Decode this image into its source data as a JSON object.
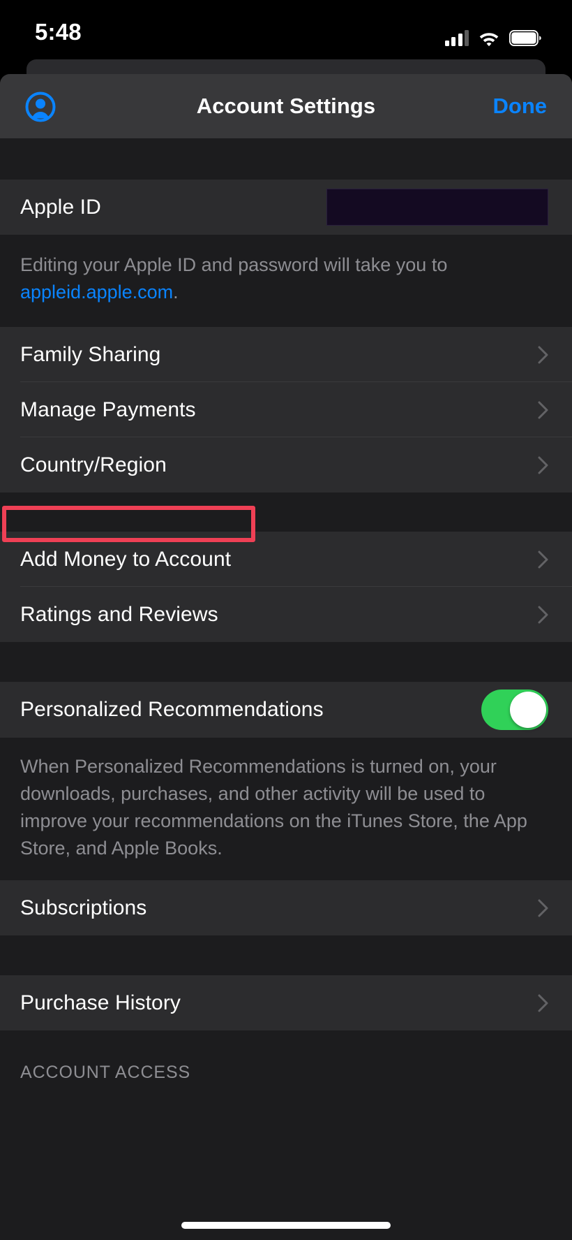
{
  "status_bar": {
    "time": "5:48",
    "cellular_icon": "cellular-signal-icon",
    "cellular_bars_filled": 3,
    "cellular_bars_total": 4,
    "wifi_icon": "wifi-icon",
    "wifi_strength": "full",
    "battery_icon": "battery-icon",
    "battery_level": "full"
  },
  "nav": {
    "avatar_icon": "account-avatar-icon",
    "title": "Account Settings",
    "done_label": "Done"
  },
  "sections": {
    "apple_id": {
      "label": "Apple ID",
      "value_redacted": true,
      "footer_prefix": "Editing your Apple ID and password will take you to ",
      "footer_link": "appleid.apple.com",
      "footer_suffix": "."
    },
    "account_group": {
      "items": [
        {
          "label": "Family Sharing",
          "accessory": "chevron-right-icon"
        },
        {
          "label": "Manage Payments",
          "accessory": "chevron-right-icon"
        },
        {
          "label": "Country/Region",
          "accessory": "chevron-right-icon",
          "highlighted": true
        }
      ]
    },
    "money_group": {
      "items": [
        {
          "label": "Add Money to Account",
          "accessory": "chevron-right-icon"
        },
        {
          "label": "Ratings and Reviews",
          "accessory": "chevron-right-icon"
        }
      ]
    },
    "recommendations": {
      "label": "Personalized Recommendations",
      "toggle_state": "on",
      "footer": "When Personalized Recommendations is turned on, your downloads, purchases, and other activity will be used to improve your recommendations on the iTunes Store, the App Store, and Apple Books."
    },
    "subscriptions": {
      "items": [
        {
          "label": "Subscriptions",
          "accessory": "chevron-right-icon"
        }
      ]
    },
    "purchase_history": {
      "items": [
        {
          "label": "Purchase History",
          "accessory": "chevron-right-icon"
        }
      ]
    },
    "account_access": {
      "header": "ACCOUNT ACCESS"
    }
  },
  "annotation": {
    "target": "Country/Region",
    "color": "#ef4055"
  },
  "colors": {
    "accent_blue": "#0a84ff",
    "toggle_green": "#30d158",
    "row_background": "#2c2c2e",
    "page_background": "#1c1c1e",
    "nav_background": "#38383a",
    "secondary_text": "#8e8e93",
    "annotation_red": "#ef4055"
  }
}
